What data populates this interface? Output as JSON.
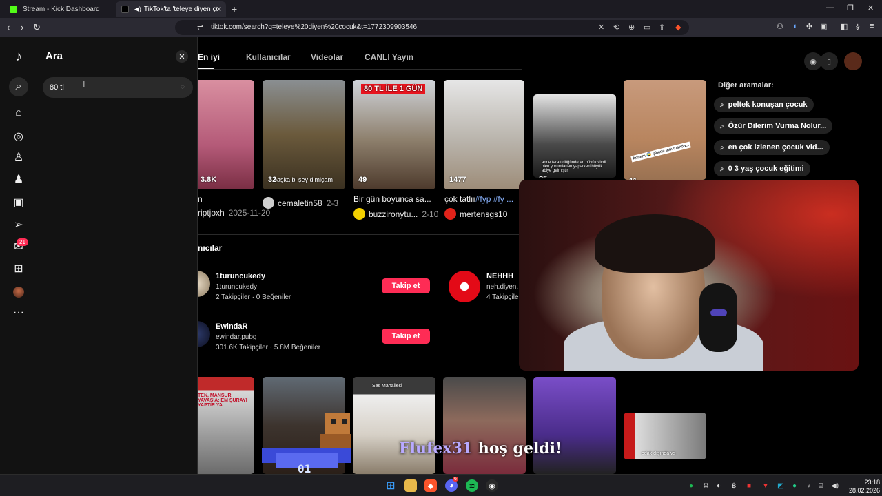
{
  "browser": {
    "tabs": [
      {
        "title": "Stream - Kick Dashboard"
      },
      {
        "title": "TikTok'ta 'teleye diyen çocuk'"
      }
    ],
    "url": "tiktok.com/search?q=teleye%20diyen%20cocuk&t=1772309903546"
  },
  "rail": {
    "messages_badge": "21"
  },
  "search_panel": {
    "title": "Ara",
    "input_value": "80 tl"
  },
  "tabs": {
    "top": "En iyi",
    "users": "Kullanıcılar",
    "videos": "Videolar",
    "live": "CANLI Yayın"
  },
  "videos_row1": [
    {
      "likes": "3.8K",
      "caption": "n",
      "author": "riptjoxh",
      "date": "2025-11-20"
    },
    {
      "likes": "32",
      "caption": "",
      "author": "cemaletin58",
      "date": "2-3",
      "overlay": "başka bi şey dimiçam"
    },
    {
      "likes": "49",
      "caption": "Bir gün boyunca sa...",
      "author": "buzzironytu...",
      "date": "2-10",
      "overlay": "80 TL İLE 1 GÜN"
    },
    {
      "likes": "1477",
      "caption": "çok tatlıı",
      "hashtags": "#fyp #fy ...",
      "author": "mertensgs10",
      "date": ""
    },
    {
      "likes": "25",
      "overlay": "anne tarafı düğünde en büyük vicdi olen yorumlanan yaparken büyük abiye gelmiştir"
    },
    {
      "likes": "11",
      "overlay": "Annem 😰 iphone aldı manda..."
    }
  ],
  "users_section": {
    "title": "nıcılar",
    "users": [
      {
        "name": "1turuncukedy",
        "handle": "1turuncukedy",
        "followers": "2 Takipçiler",
        "likes": "0 Beğeniler",
        "follow_label": "Takip et"
      },
      {
        "name": "EwindaR",
        "handle": "ewindar.pubg",
        "followers": "301.6K Takipçiler",
        "likes": "5.8M Beğeniler",
        "follow_label": "Takip et"
      },
      {
        "name": "NEHHH",
        "handle": "neh.diyen.",
        "followers": "4 Takipçiler"
      }
    ]
  },
  "other_searches": {
    "title": "Diğer aramalar:",
    "items": [
      "peltek konuşan çocuk",
      "Özür Dilerim Vurma Nolur...",
      "en çok izlenen çocuk vid...",
      "0 3 yaş çocuk eğitimi"
    ]
  },
  "videos_row2": [
    {
      "overlay": "TEN, MANSUR YAVAŞ'A: EM ŞURAYI YAPTIR YA"
    },
    {
      "overlay": ""
    },
    {
      "overlay": "Ses Mahallesi"
    },
    {
      "overlay": ""
    },
    {
      "overlay": ""
    },
    {
      "overlay": "odak dışında vs"
    }
  ],
  "stream_overlay": {
    "follower_name": "Flufex31",
    "message": "hoş geldi!",
    "pixel_label": "01"
  },
  "taskbar": {
    "time": "23:18",
    "date": "28.02.2026",
    "discord_badge": "6"
  }
}
